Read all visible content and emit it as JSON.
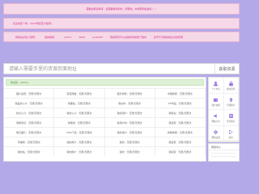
{
  "notices": {
    "top": "需要白嫖请等待，您需要等待的时，即登陆，本博客网站邀请！！",
    "second": "完全免费一样，2023年起至今使用！"
  },
  "user_bar": {
    "welcome": "我的站点名义简称：",
    "role_label": "我的等级：",
    "username": "admin",
    "count": "0000",
    "points": "ace0000",
    "points_note": "我的所有可以兑换搜索前题个数句",
    "footer_note": "给予不对我的信息点搜索者"
  },
  "search": {
    "placeholder": "请输入需要手里的资源页面地址",
    "button": "获取资源"
  },
  "main": {
    "welcome": "欢迎您，admin。",
    "cells": [
      [
        "图片运费：无限/无限次",
        "百度网盘：无限/无限次",
        "图片收费：无限/无限次",
        "中国收费：无限/无限次"
      ],
      [
        "我品的公众：无限/无限次",
        "我要站：无限/无限次",
        "我在中：无限/无限次",
        "PS作品：无限/无限次"
      ],
      [
        "热点公众：无限/无限次",
        "我的公众：无限/无限次",
        "我的用户：无限/无限次",
        "我用站：无限/无限次"
      ],
      [
        "我能搜点：无限/无限次",
        "我能搜：无限/无限次",
        "我用户的：无限/无限次",
        "我运营：无限/无限次"
      ],
      [
        "每日图片：无限/无限次",
        "CDN下载：无限/无限次",
        "我的用户：无限/无限次",
        "我看视频：无限/无限次"
      ],
      [
        "手播网：无限/无限次",
        "我的用户：无限/无限次",
        "我的：无限/无限次",
        "我运营：无限/无限次"
      ],
      [
        "我的站：无限/无限次",
        "我的用户：无限/无限次",
        "我的：无限/无限次",
        "我运营：无限/无限次"
      ]
    ]
  },
  "sidebar": {
    "items": [
      {
        "label": "个人中心",
        "icon": "user-icon"
      },
      {
        "label": "修改密码",
        "icon": "lock-icon"
      },
      {
        "label": "账户充值",
        "icon": "wallet-icon"
      },
      {
        "label": "升级账户",
        "icon": "upgrade-icon"
      },
      {
        "label": "网站公告",
        "icon": "notice-icon"
      },
      {
        "label": "任务报价",
        "icon": "task-icon"
      },
      {
        "label": "网站设置",
        "icon": "gear-icon"
      },
      {
        "label": "退出",
        "icon": "logout-icon"
      }
    ],
    "help_title": "帮助中心"
  },
  "colors": {
    "background": "#b3a9e8",
    "notice_bg": "#f6d9e9",
    "notice_text": "#d3338a",
    "welcome_bg": "#def0d6",
    "icon_color": "#9a7be0"
  }
}
